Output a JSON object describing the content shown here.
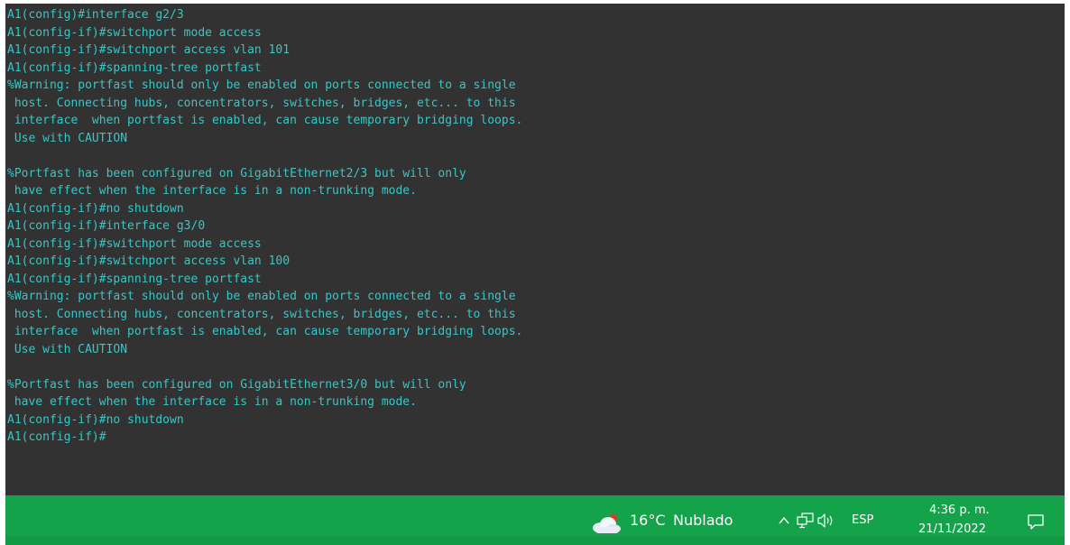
{
  "terminal": {
    "lines": [
      "A1(config)#interface g2/3",
      "A1(config-if)#switchport mode access",
      "A1(config-if)#switchport access vlan 101",
      "A1(config-if)#spanning-tree portfast",
      "%Warning: portfast should only be enabled on ports connected to a single",
      " host. Connecting hubs, concentrators, switches, bridges, etc... to this",
      " interface  when portfast is enabled, can cause temporary bridging loops.",
      " Use with CAUTION",
      "",
      "%Portfast has been configured on GigabitEthernet2/3 but will only",
      " have effect when the interface is in a non-trunking mode.",
      "A1(config-if)#no shutdown",
      "A1(config-if)#interface g3/0",
      "A1(config-if)#switchport mode access",
      "A1(config-if)#switchport access vlan 100",
      "A1(config-if)#spanning-tree portfast",
      "%Warning: portfast should only be enabled on ports connected to a single",
      " host. Connecting hubs, concentrators, switches, bridges, etc... to this",
      " interface  when portfast is enabled, can cause temporary bridging loops.",
      " Use with CAUTION",
      "",
      "%Portfast has been configured on GigabitEthernet3/0 but will only",
      " have effect when the interface is in a non-trunking mode.",
      "A1(config-if)#no shutdown",
      "A1(config-if)#"
    ]
  },
  "taskbar": {
    "weather": {
      "temperature": "16°C",
      "condition": "Nublado",
      "icon": "cloud-icon"
    },
    "language": "ESP",
    "time": "4:36 p. m.",
    "date": "21/11/2022"
  },
  "colors": {
    "terminal_background": "#323232",
    "terminal_text": "#38c6c6",
    "taskbar_background": "#14a34a"
  }
}
